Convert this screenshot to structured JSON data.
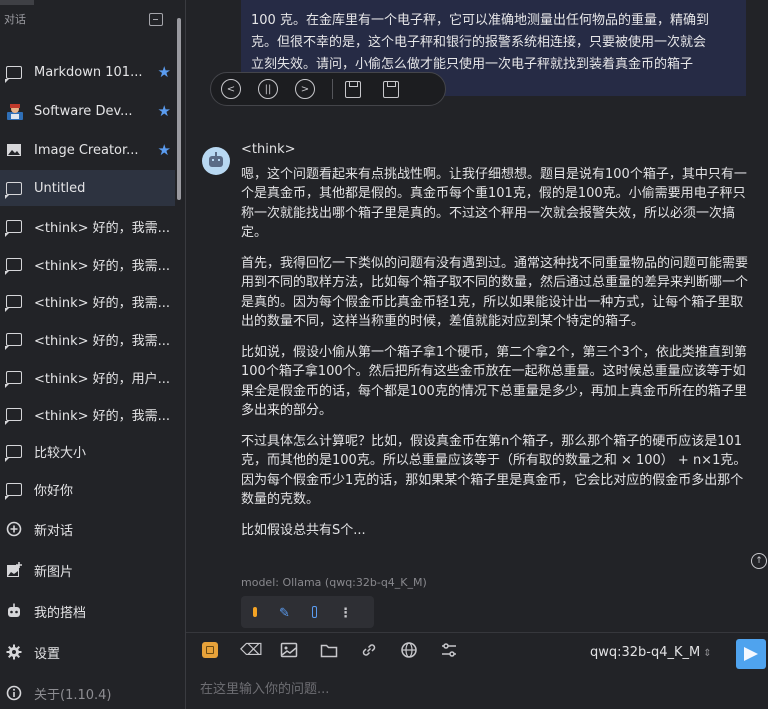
{
  "sidebar": {
    "section_title": "对话",
    "items": [
      {
        "label": "Markdown 101...",
        "icon": "chat-icon",
        "starred": true
      },
      {
        "label": "Software Dev...",
        "icon": "developer-avatar-icon",
        "starred": true
      },
      {
        "label": "Image Creator...",
        "icon": "image-icon",
        "starred": true
      },
      {
        "label": "Untitled",
        "icon": "chat-icon",
        "starred": false,
        "active": true
      },
      {
        "label": "<think> 好的，我需...",
        "icon": "chat-icon"
      },
      {
        "label": "<think> 好的，我需...",
        "icon": "chat-icon"
      },
      {
        "label": "<think> 好的，我需...",
        "icon": "chat-icon"
      },
      {
        "label": "<think> 好的，我需...",
        "icon": "chat-icon"
      },
      {
        "label": "<think> 好的，用户...",
        "icon": "chat-icon"
      },
      {
        "label": "<think> 好的，我需...",
        "icon": "chat-icon"
      },
      {
        "label": "比较大小",
        "icon": "chat-icon"
      },
      {
        "label": "你好你",
        "icon": "chat-icon"
      }
    ],
    "new_chat": "新对话",
    "new_image": "新图片",
    "my_copilots": "我的搭档",
    "settings": "设置",
    "about": "关于(1.10.4)"
  },
  "user_message": {
    "lines": [
      "100 克。在金库里有一个电子秤，它可以准确地测量出任何物品的重量，精确到",
      "克。但很不幸的是，这个电子秤和银行的报警系统相连接，只要被使用一次就会",
      "立刻失效。请问，小偷怎么做才能只使用一次电子秤就找到装着真金币的箱子"
    ]
  },
  "assistant": {
    "think_tag": "<think>",
    "paragraphs": [
      "嗯，这个问题看起来有点挑战性啊。让我仔细想想。题目是说有100个箱子，其中只有一个是真金币，其他都是假的。真金币每个重101克，假的是100克。小偷需要用电子秤只称一次就能找出哪个箱子里是真的。不过这个秤用一次就会报警失效，所以必须一次搞定。",
      "首先，我得回忆一下类似的问题有没有遇到过。通常这种找不同重量物品的问题可能需要用到不同的取样方法，比如每个箱子取不同的数量，然后通过总重量的差异来判断哪一个是真的。因为每个假金币比真金币轻1克，所以如果能设计出一种方式，让每个箱子里取出的数量不同，这样当称重的时候，差值就能对应到某个特定的箱子。",
      "比如说，假设小偷从第一个箱子拿1个硬币，第二个拿2个，第三个3个，依此类推直到第100个箱子拿100个。然后把所有这些金币放在一起称总重量。这时候总重量应该等于如果全是假金币的话，每个都是100克的情况下总重量是多少，再加上真金币所在的箱子里多出来的部分。",
      "不过具体怎么计算呢？比如，假设真金币在第n个箱子，那么那个箱子的硬币应该是101克，而其他的是100克。所以总重量应该等于（所有取的数量之和 × 100） + n×1克。因为每个假金币少1克的话，那如果某个箱子里是真金币，它会比对应的假金币多出那个数量的克数。",
      "比如假设总共有S个..."
    ],
    "model_label": "model: Ollama (qwq:32b-q4_K_M)"
  },
  "input": {
    "model_name": "qwq:32b-q4_K_M",
    "placeholder": "在这里输入你的问题..."
  },
  "colors": {
    "accent": "#4fa3ee",
    "star": "#5b9cf0",
    "stop": "#f4a324"
  }
}
